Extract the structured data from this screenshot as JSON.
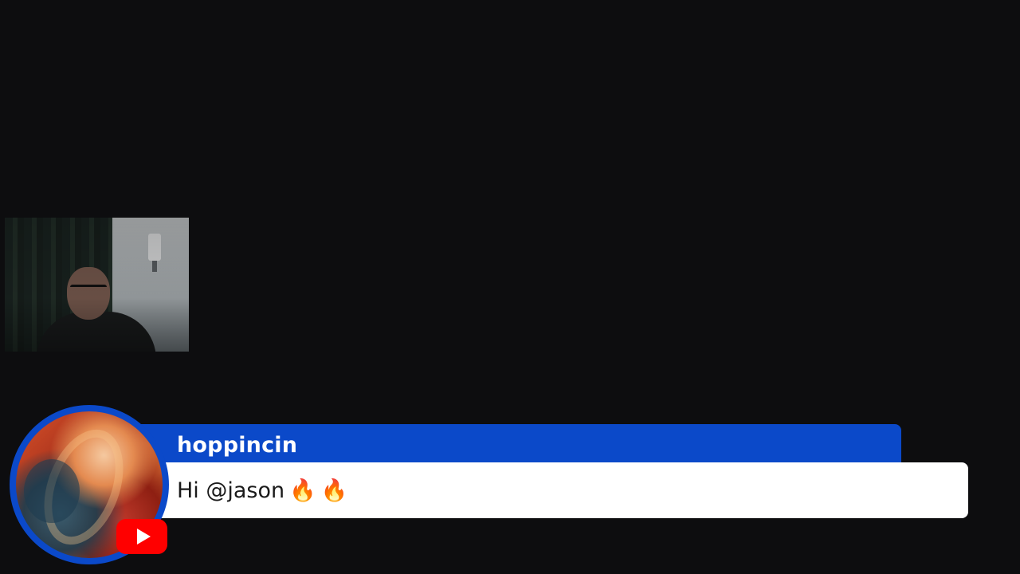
{
  "webcam": {
    "label": "webcam-feed"
  },
  "chat_message": {
    "username": "hoppincin",
    "text": "Hi @jason",
    "emojis": [
      "🔥",
      "🔥"
    ],
    "platform_icon": "youtube-icon",
    "avatar_icon": "user-avatar",
    "accent_color": "#0b49c9",
    "message_bg": "#ffffff",
    "platform_color": "#ff0000"
  }
}
